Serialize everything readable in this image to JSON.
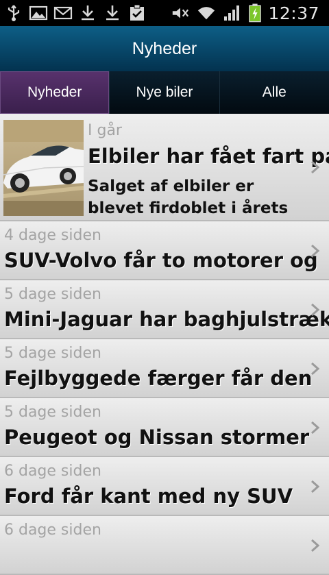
{
  "status_bar": {
    "time": "12:37",
    "left_icons": [
      "usb-icon",
      "image-icon",
      "mail-icon",
      "download-icon",
      "download-icon",
      "clipboard-check-icon"
    ],
    "right_icons": [
      "mute-icon",
      "wifi-icon",
      "signal-icon",
      "battery-charging-icon"
    ]
  },
  "header": {
    "title": "Nyheder"
  },
  "tabs": [
    {
      "label": "Nyheder",
      "active": true
    },
    {
      "label": "Nye biler",
      "active": false
    },
    {
      "label": "Alle",
      "active": false
    }
  ],
  "articles": [
    {
      "date": "I går",
      "headline": "Elbiler har fået fart på",
      "teaser": "Salget af elbiler er blevet firdoblet i årets første",
      "has_image": true
    },
    {
      "date": "4 dage siden",
      "headline": "SUV-Volvo får to motorer og"
    },
    {
      "date": "5 dage siden",
      "headline": "Mini-Jaguar har baghjulstræk"
    },
    {
      "date": "5 dage siden",
      "headline": "Fejlbyggede færger får den"
    },
    {
      "date": "5 dage siden",
      "headline": "Peugeot og Nissan stormer"
    },
    {
      "date": "6 dage siden",
      "headline": "Ford får kant med ny SUV"
    },
    {
      "date": "6 dage siden",
      "headline": ""
    }
  ],
  "colors": {
    "header_top": "#0d5e86",
    "header_bottom": "#03324f",
    "tab_active": "#58326d",
    "date_text": "#a4a4a4"
  }
}
